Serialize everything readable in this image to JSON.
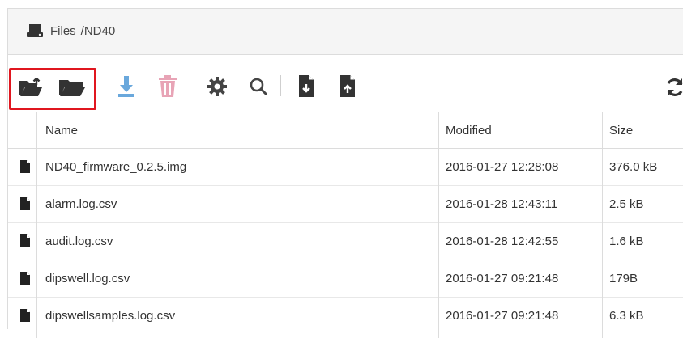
{
  "header": {
    "title_prefix": "Files",
    "path": "/ND40",
    "icon": "drive-icon"
  },
  "toolbar": {
    "icons": [
      "upload-folder-icon",
      "open-folder-icon",
      "download-icon",
      "delete-icon",
      "settings-icon",
      "search-icon",
      "file-download-icon",
      "file-upload-icon",
      "refresh-icon"
    ],
    "highlight_color": "#e0161f",
    "download_color": "#6aa8dc",
    "delete_color": "#e8a4b6"
  },
  "table": {
    "columns": [
      "Name",
      "Modified",
      "Size"
    ],
    "rows": [
      {
        "name": "ND40_firmware_0.2.5.img",
        "modified": "2016-01-27 12:28:08",
        "size": "376.0 kB"
      },
      {
        "name": "alarm.log.csv",
        "modified": "2016-01-28 12:43:11",
        "size": "2.5 kB"
      },
      {
        "name": "audit.log.csv",
        "modified": "2016-01-28 12:42:55",
        "size": "1.6 kB"
      },
      {
        "name": "dipswell.log.csv",
        "modified": "2016-01-27 09:21:48",
        "size": "179B"
      },
      {
        "name": "dipswellsamples.log.csv",
        "modified": "2016-01-27 09:21:48",
        "size": "6.3 kB"
      }
    ]
  }
}
